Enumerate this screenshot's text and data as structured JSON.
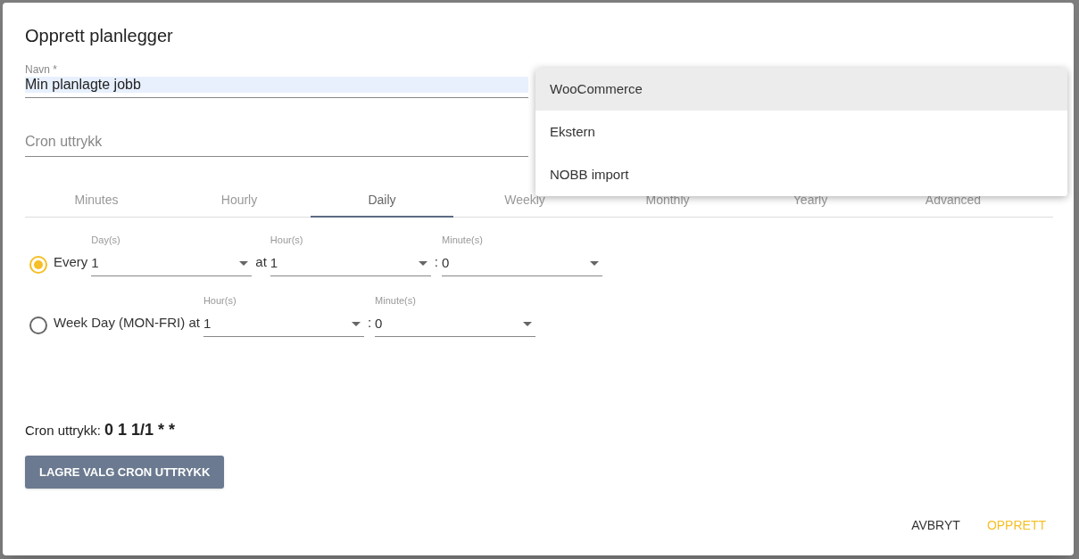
{
  "dialog": {
    "title": "Opprett planlegger"
  },
  "name_field": {
    "label": "Navn *",
    "value": "Min planlagte jobb"
  },
  "cron_field": {
    "placeholder": "Cron uttrykk"
  },
  "job_type_menu": {
    "items": [
      {
        "label": "WooCommerce",
        "selected": true
      },
      {
        "label": "Ekstern",
        "selected": false
      },
      {
        "label": "NOBB import",
        "selected": false
      }
    ]
  },
  "tabs": [
    {
      "label": "Minutes",
      "selected": false
    },
    {
      "label": "Hourly",
      "selected": false
    },
    {
      "label": "Daily",
      "selected": true
    },
    {
      "label": "Weekly",
      "selected": false
    },
    {
      "label": "Monthly",
      "selected": false
    },
    {
      "label": "Yearly",
      "selected": false
    },
    {
      "label": "Advanced",
      "selected": false
    }
  ],
  "options": [
    {
      "selected": true,
      "segments": [
        {
          "kind": "text",
          "text": "Every"
        },
        {
          "kind": "select",
          "label": "Day(s)",
          "value": "1"
        },
        {
          "kind": "text",
          "text": "at"
        },
        {
          "kind": "select",
          "label": "Hour(s)",
          "value": "1"
        },
        {
          "kind": "text",
          "text": ":"
        },
        {
          "kind": "select",
          "label": "Minute(s)",
          "value": "0"
        }
      ]
    },
    {
      "selected": false,
      "segments": [
        {
          "kind": "text",
          "text": "Week Day (MON-FRI) at"
        },
        {
          "kind": "select",
          "label": "Hour(s)",
          "value": "1"
        },
        {
          "kind": "text",
          "text": ":"
        },
        {
          "kind": "select",
          "label": "Minute(s)",
          "value": "0"
        }
      ]
    }
  ],
  "result": {
    "label": "Cron uttrykk:",
    "value": "0 1 1/1 * *"
  },
  "save_button": {
    "label": "LAGRE VALG CRON UTTRYKK"
  },
  "actions": [
    {
      "label": "AVBRYT",
      "kind": "default"
    },
    {
      "label": "OPPRETT",
      "kind": "primary"
    }
  ]
}
